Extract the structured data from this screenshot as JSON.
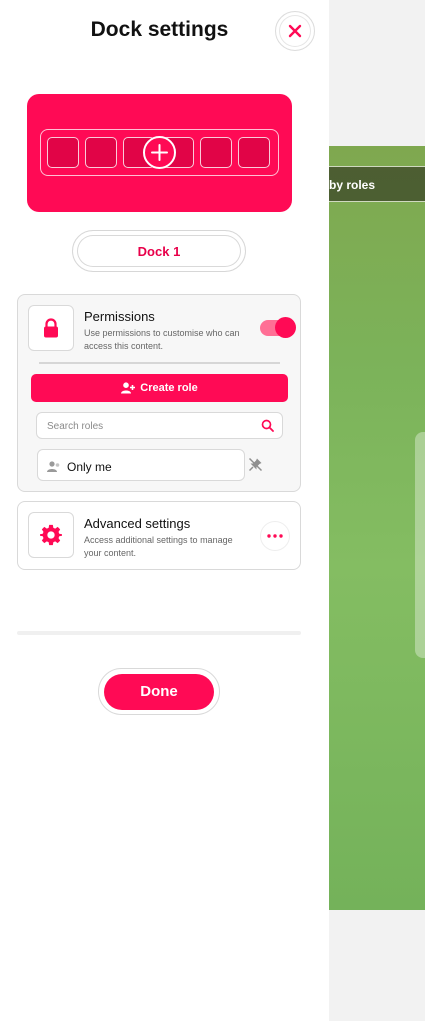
{
  "dialog": {
    "title": "Dock settings",
    "close_icon": "close-icon"
  },
  "dock": {
    "preview_color": "#ff0a55",
    "slot_count": 6,
    "add_icon": "plus-icon",
    "name": "Dock 1"
  },
  "permissions": {
    "title": "Permissions",
    "description": "Use permissions to customise who can access this content.",
    "icon": "lock-icon",
    "enabled": true,
    "create_role_label": "Create role",
    "create_role_icon": "user-plus-icon",
    "search": {
      "placeholder": "Search roles",
      "icon": "search-icon"
    },
    "roles": [
      {
        "label": "Only me",
        "icon": "user-icon",
        "action_icon": "unpin-icon"
      }
    ]
  },
  "advanced": {
    "title": "Advanced settings",
    "description": "Access additional settings to manage your content.",
    "icon": "gear-icon",
    "more_icon": "more-horizontal-icon"
  },
  "footer": {
    "done_label": "Done"
  },
  "background": {
    "bar_text": "by roles"
  },
  "colors": {
    "accent": "#ff0a55",
    "toggle_track": "#ff6f95"
  }
}
